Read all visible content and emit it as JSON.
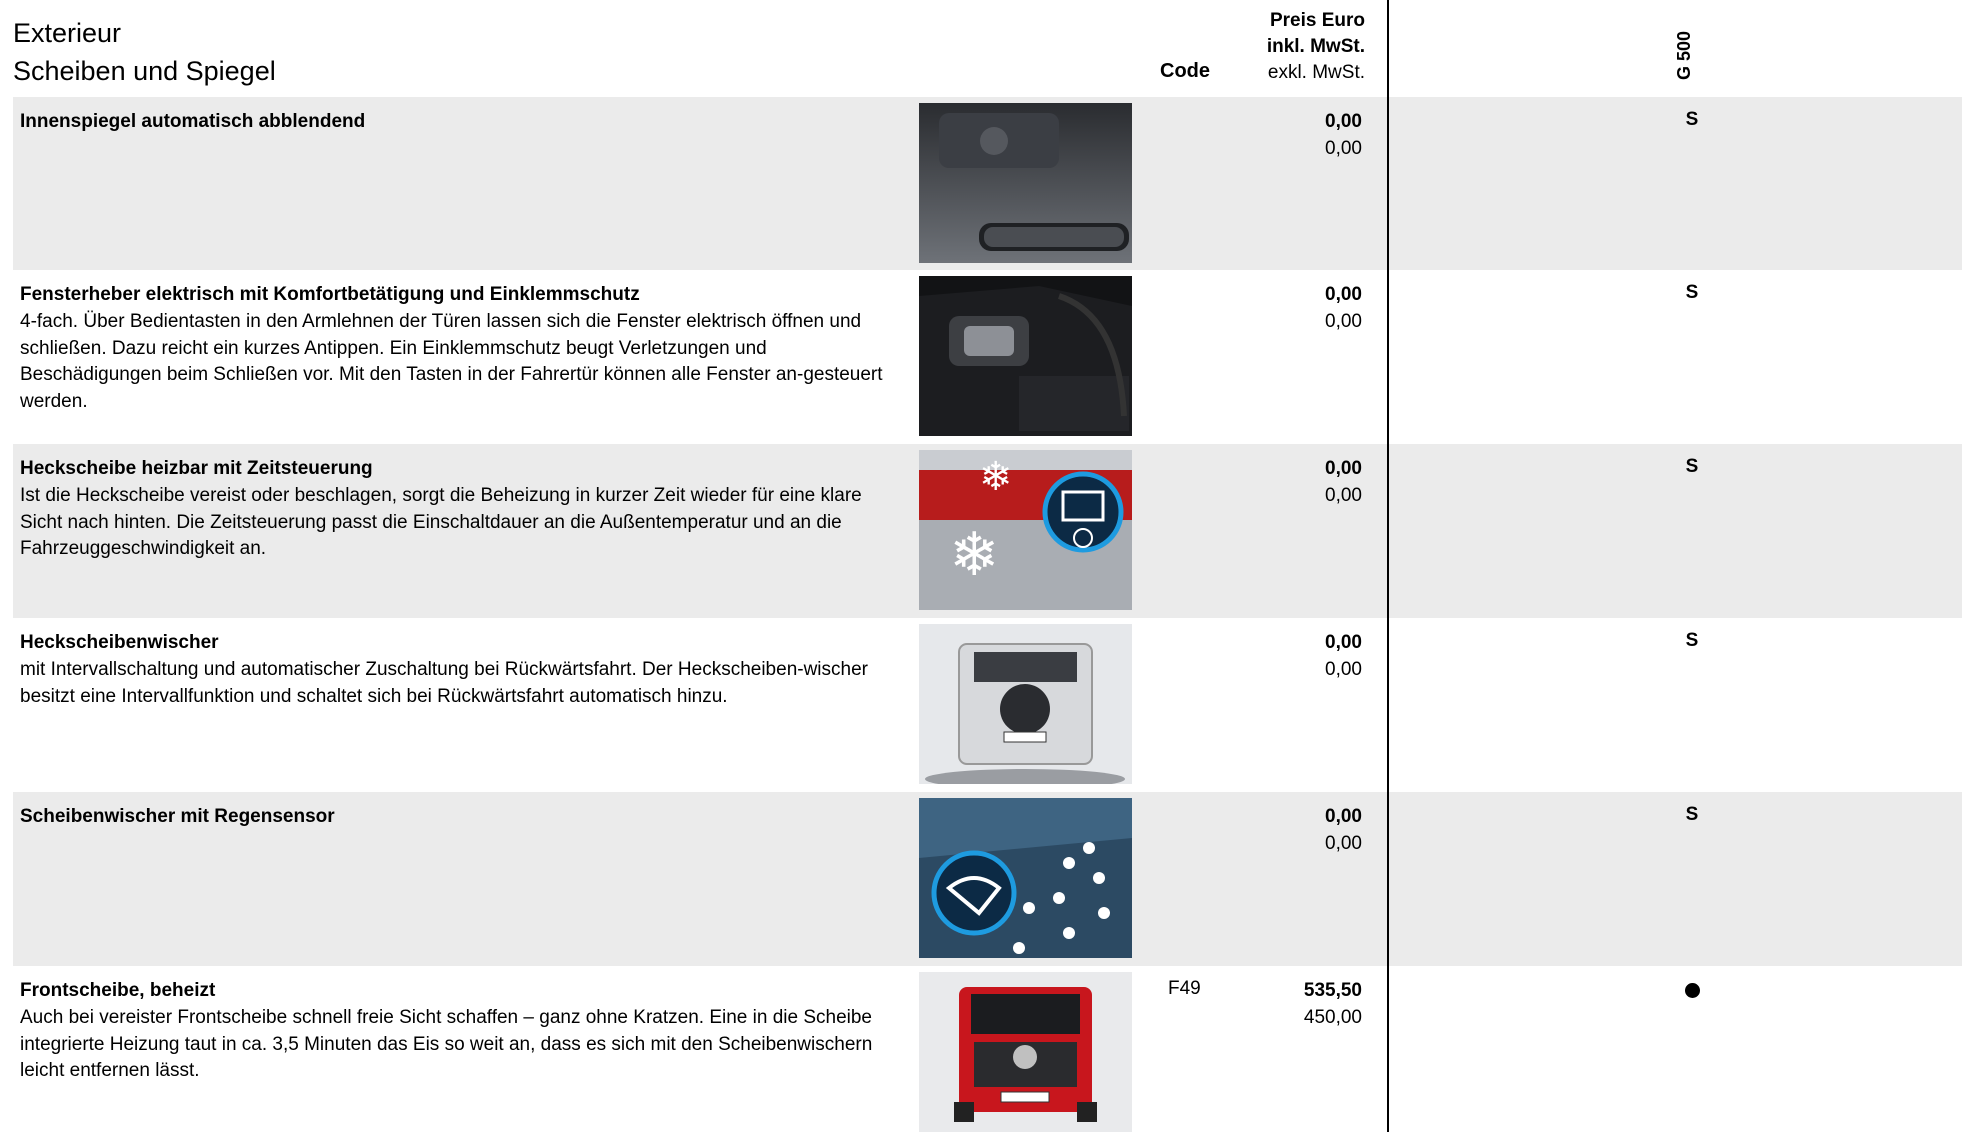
{
  "header": {
    "line1": "Exterieur",
    "line2": "Scheiben und Spiegel",
    "code_label": "Code",
    "price_line1": "Preis Euro",
    "price_line2": "inkl. MwSt.",
    "price_line3": "exkl. MwSt.",
    "model": "G 500"
  },
  "rows": [
    {
      "title": "Innenspiegel automatisch abblendend",
      "desc": "",
      "code": "",
      "price_inkl": "0,00",
      "price_exkl": "0,00",
      "availability": "S",
      "image": "interior-mirror-photo"
    },
    {
      "title": "Fensterheber elektrisch mit Komfortbetätigung und Einklemmschutz",
      "desc": "4-fach. Über Bedientasten in den Armlehnen der Türen lassen sich die Fenster elektrisch öffnen und schließen. Dazu reicht ein kurzes Antippen. Ein Einklemmschutz beugt Verletzungen und Beschädigungen beim Schließen vor. Mit den Tasten in der Fahrertür können alle Fenster an-gesteuert werden.",
      "code": "",
      "price_inkl": "0,00",
      "price_exkl": "0,00",
      "availability": "S",
      "image": "door-window-switch-photo"
    },
    {
      "title": "Heckscheibe heizbar mit Zeitsteuerung",
      "desc": "Ist die Heckscheibe vereist oder beschlagen, sorgt die Beheizung in kurzer Zeit wieder für eine klare Sicht nach hinten. Die Zeitsteuerung passt die Einschaltdauer an die Außentemperatur und an die Fahrzeuggeschwindigkeit an.",
      "code": "",
      "price_inkl": "0,00",
      "price_exkl": "0,00",
      "availability": "S",
      "image": "rear-window-heating-photo"
    },
    {
      "title": "Heckscheibenwischer",
      "desc": "mit Intervallschaltung und automatischer Zuschaltung bei Rückwärtsfahrt. Der Heckscheiben-wischer besitzt eine Intervallfunktion und schaltet sich bei Rückwärtsfahrt automatisch hinzu.",
      "code": "",
      "price_inkl": "0,00",
      "price_exkl": "0,00",
      "availability": "S",
      "image": "rear-wiper-photo"
    },
    {
      "title": "Scheibenwischer mit Regensensor",
      "desc": "",
      "code": "",
      "price_inkl": "0,00",
      "price_exkl": "0,00",
      "availability": "S",
      "image": "rain-sensor-photo"
    },
    {
      "title": "Frontscheibe, beheizt",
      "desc": "Auch bei vereister Frontscheibe schnell freie Sicht schaffen – ganz ohne Kratzen. Eine in die Scheibe integrierte Heizung taut in ca. 3,5 Minuten das Eis so weit an, dass es sich mit den Scheibenwischern leicht entfernen lässt.",
      "code": "F49",
      "price_inkl": "535,50",
      "price_exkl": "450,00",
      "availability": "●",
      "image": "heated-windscreen-photo"
    }
  ]
}
